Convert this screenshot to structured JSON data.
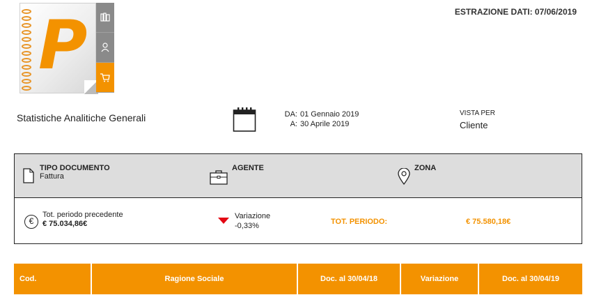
{
  "header": {
    "extraction": "ESTRAZIONE DATI: 07/06/2019"
  },
  "logo": {
    "letter": "P",
    "tabs": [
      "library-icon",
      "person-icon",
      "cart-icon"
    ]
  },
  "report": {
    "title": "Statistiche Analitiche Generali"
  },
  "period": {
    "from_label": "DA:",
    "from_value": "01 Gennaio 2019",
    "to_label": "A:",
    "to_value": "30 Aprile 2019"
  },
  "view": {
    "label": "VISTA PER",
    "value": "Cliente"
  },
  "filters": {
    "doc_type_label": "TIPO DOCUMENTO",
    "doc_type_value": "Fattura",
    "agent_label": "AGENTE",
    "zone_label": "ZONA"
  },
  "totals": {
    "prev_label": "Tot. periodo precedente",
    "prev_value": "€ 75.034,86€",
    "variation_label": "Variazione",
    "variation_value": "-0,33%",
    "period_label": "TOT. PERIODO:",
    "period_value": "€ 75.580,18€"
  },
  "table": {
    "columns": [
      "Cod.",
      "Ragione Sociale",
      "Doc. al 30/04/18",
      "Variazione",
      "Doc. al 30/04/19"
    ]
  },
  "colors": {
    "accent": "#f39200",
    "negative": "#e30613",
    "filter_bg": "#dddddd"
  }
}
